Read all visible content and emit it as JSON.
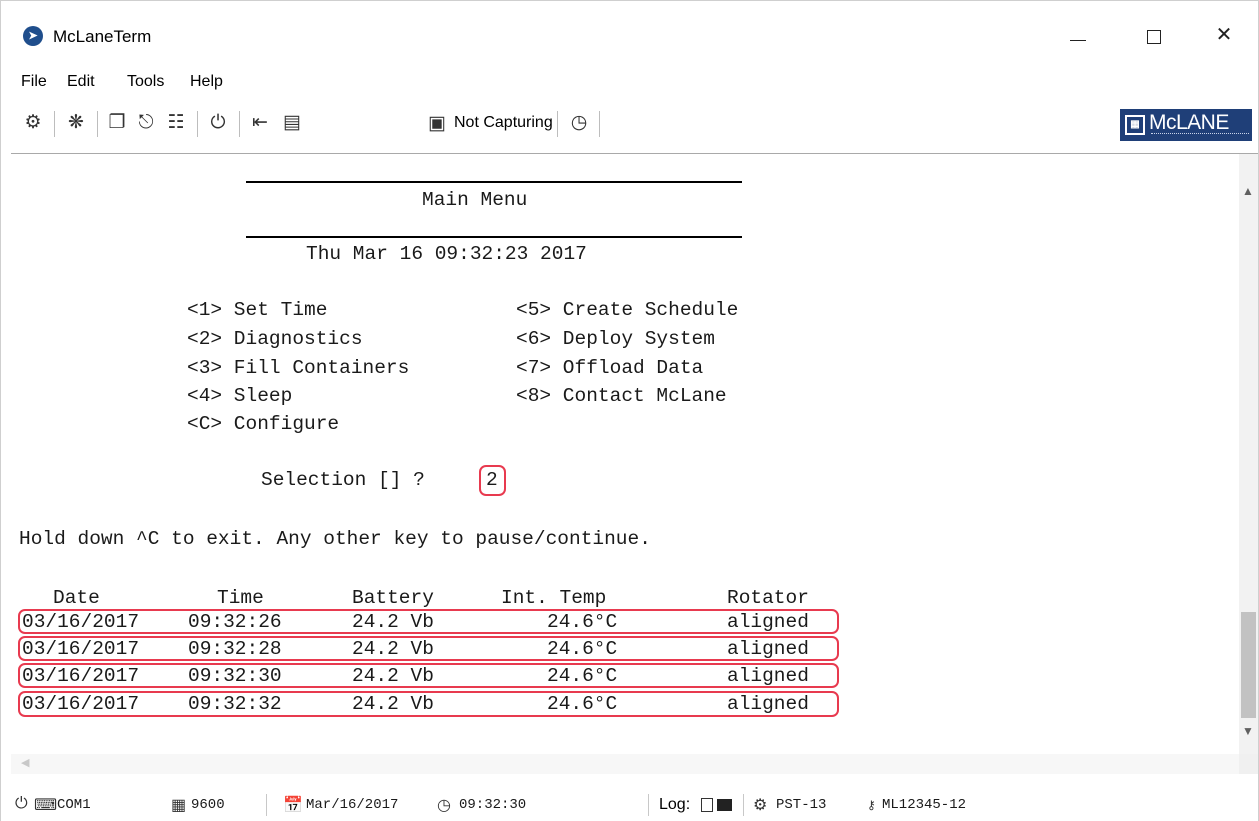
{
  "window": {
    "title": "McLaneTerm",
    "app_icon": "mclane-term-app-icon"
  },
  "menu": [
    "File",
    "Edit",
    "Tools",
    "Help"
  ],
  "toolbar": {
    "capture_status": "Not Capturing",
    "icons": [
      "gear-icon",
      "bug-icon",
      "copy-icon",
      "paste-icon",
      "clipboard-icon",
      "power-icon",
      "send-icon",
      "capture-icon",
      "folder-icon",
      "break-icon"
    ],
    "logo_text": "McLANE"
  },
  "terminal": {
    "title": "Main Menu",
    "datetime": "Thu Mar 16 09:32:23 2017",
    "menu_left": [
      "<1> Set Time",
      "<2> Diagnostics",
      "<3> Fill Containers",
      "<4> Sleep",
      "<C> Configure"
    ],
    "menu_right": [
      "<5> Create Schedule",
      "<6> Deploy System",
      "<7> Offload Data",
      "<8> Contact McLane"
    ],
    "selection_prompt": "Selection [] ?",
    "selection_value": "2",
    "hint": "Hold down ^C to exit. Any other key to pause/continue.",
    "table_headers": [
      "Date",
      "Time",
      "Battery",
      "Int. Temp",
      "Rotator"
    ],
    "rows": [
      [
        "03/16/2017",
        "09:32:26",
        "24.2 Vb",
        "24.6°C",
        "aligned"
      ],
      [
        "03/16/2017",
        "09:32:28",
        "24.2 Vb",
        "24.6°C",
        "aligned"
      ],
      [
        "03/16/2017",
        "09:32:30",
        "24.2 Vb",
        "24.6°C",
        "aligned"
      ],
      [
        "03/16/2017",
        "09:32:32",
        "24.2 Vb",
        "24.6°C",
        "aligned"
      ]
    ],
    "highlight_color": "#e83a4f"
  },
  "status": {
    "port": "COM1",
    "baud": "9600",
    "date": "Mar/16/2017",
    "time": "09:32:30",
    "log_label": "Log:",
    "timezone": "PST-13",
    "serial": "ML12345-12"
  }
}
